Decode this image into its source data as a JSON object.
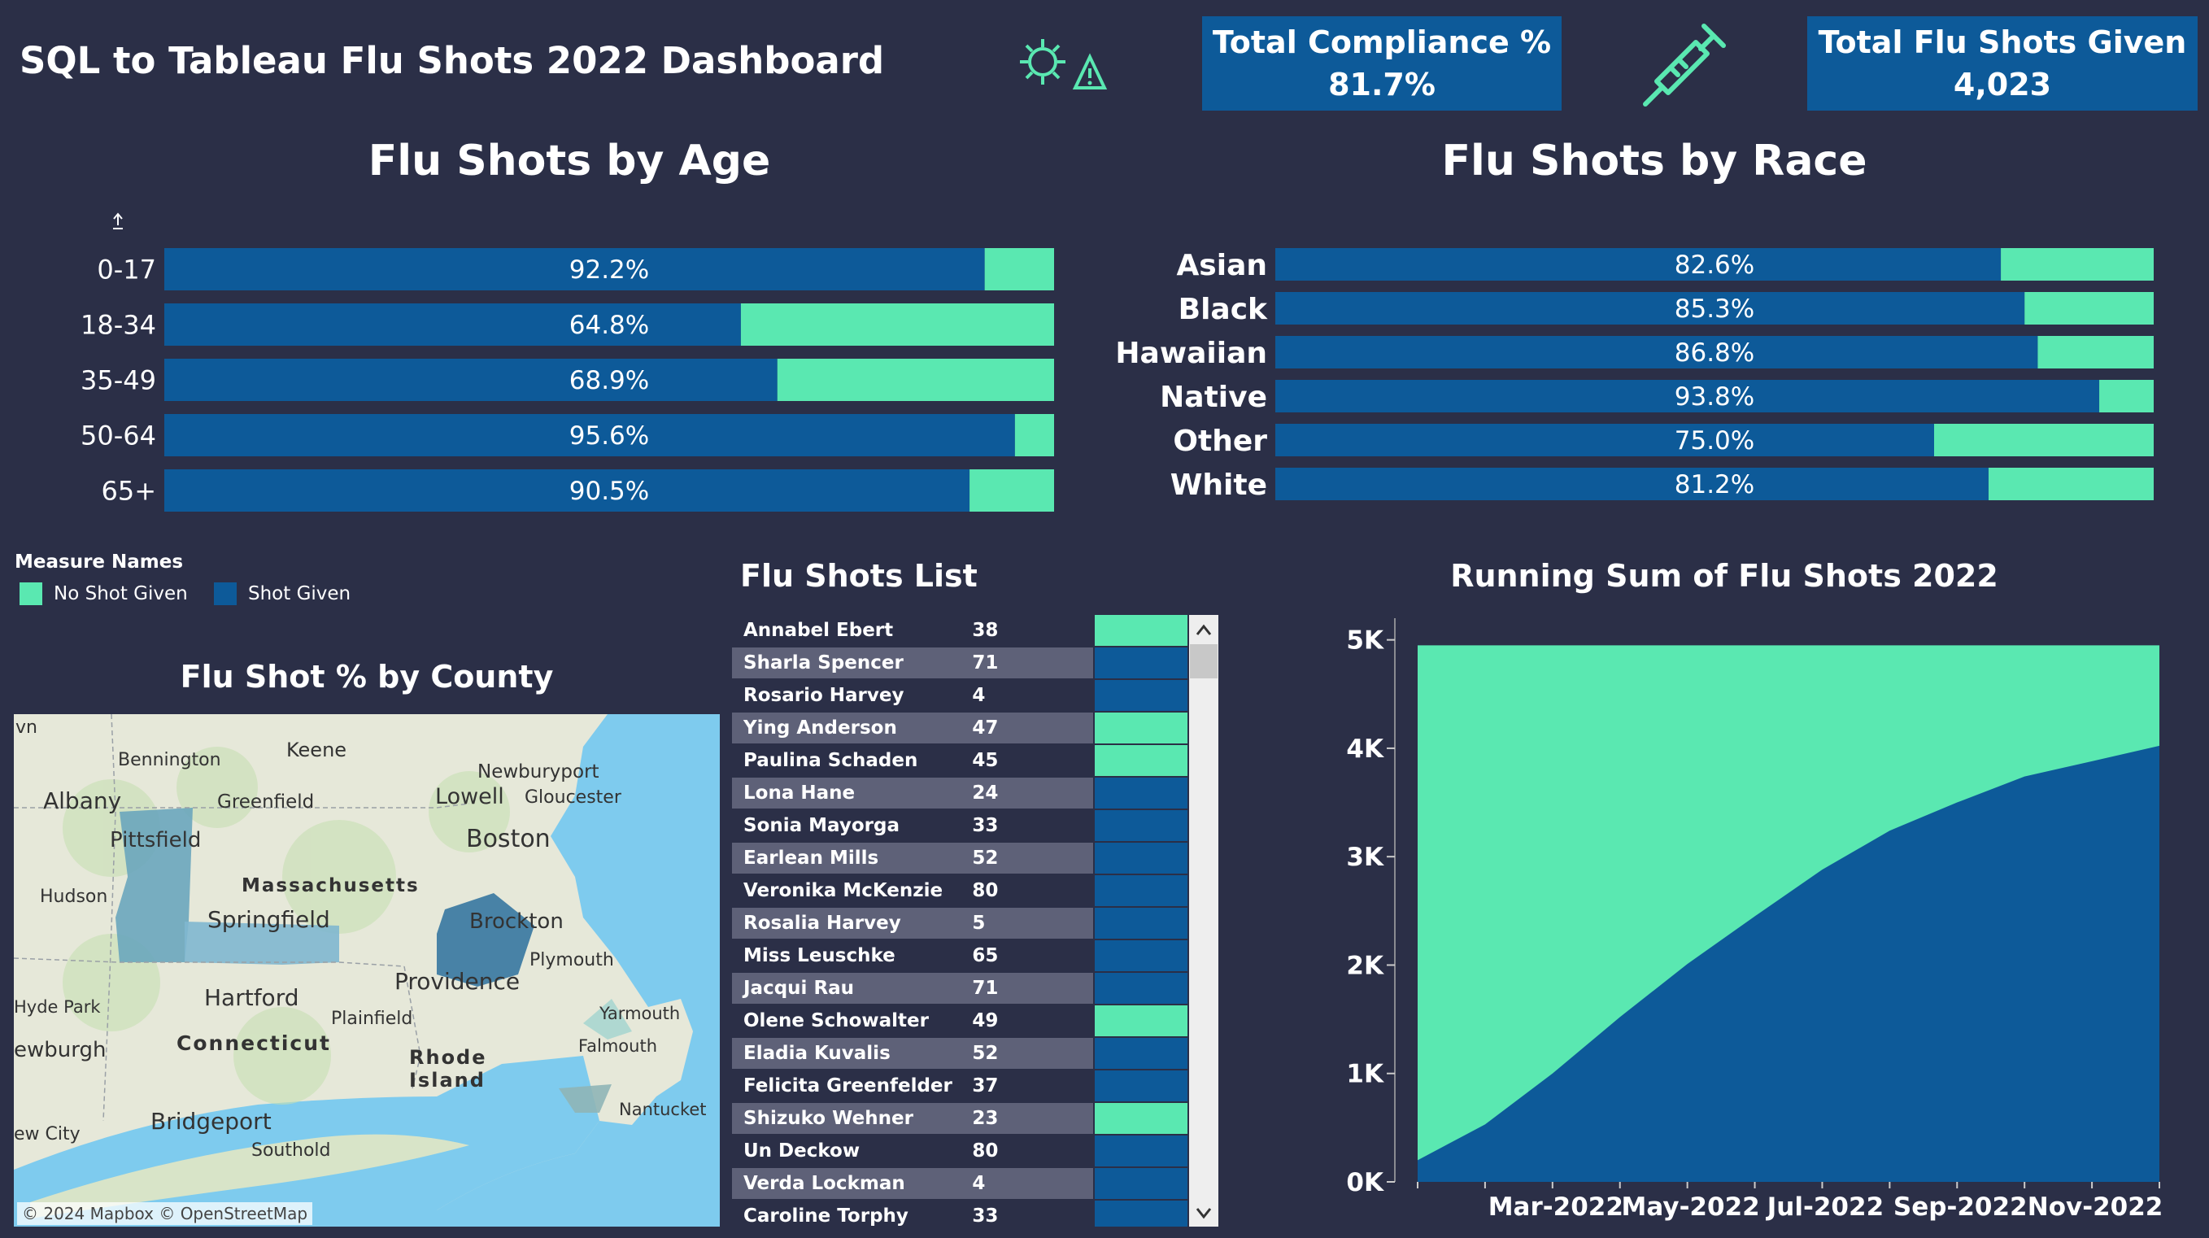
{
  "header": {
    "title": "SQL to Tableau Flu Shots 2022 Dashboard",
    "compliance_label": "Total Compliance %",
    "compliance_value": "81.7%",
    "total_label": "Total Flu Shots Given",
    "total_value": "4,023",
    "icons": [
      "virus-warning-icon",
      "syringe-icon"
    ]
  },
  "colors": {
    "shot_given": "#0d5a99",
    "no_shot": "#5ae8b1",
    "background": "#2b2f47"
  },
  "legend": {
    "title": "Measure Names",
    "items": [
      {
        "label": "No Shot Given",
        "color": "#5ae8b1"
      },
      {
        "label": "Shot Given",
        "color": "#0d5a99"
      }
    ]
  },
  "chart_data": [
    {
      "type": "bar",
      "title": "Flu Shots by Age",
      "categories": [
        "0-17",
        "18-34",
        "35-49",
        "50-64",
        "65+"
      ],
      "series": [
        {
          "name": "Shot Given",
          "values": [
            92.2,
            64.8,
            68.9,
            95.6,
            90.5
          ]
        },
        {
          "name": "No Shot Given",
          "values": [
            7.8,
            35.2,
            31.1,
            4.4,
            9.5
          ]
        }
      ],
      "labels": [
        "92.2%",
        "64.8%",
        "68.9%",
        "95.6%",
        "90.5%"
      ],
      "xlim": [
        0,
        100
      ]
    },
    {
      "type": "bar",
      "title": "Flu Shots by Race",
      "categories": [
        "Asian",
        "Black",
        "Hawaiian",
        "Native",
        "Other",
        "White"
      ],
      "series": [
        {
          "name": "Shot Given",
          "values": [
            82.6,
            85.3,
            86.8,
            93.8,
            75.0,
            81.2
          ]
        },
        {
          "name": "No Shot Given",
          "values": [
            17.4,
            14.7,
            13.2,
            6.2,
            25.0,
            18.8
          ]
        }
      ],
      "labels": [
        "82.6%",
        "85.3%",
        "86.8%",
        "93.8%",
        "75.0%",
        "81.2%"
      ],
      "xlim": [
        0,
        100
      ]
    },
    {
      "type": "area",
      "title": "Running Sum of Flu Shots 2022",
      "x": [
        "2022-01",
        "2022-02",
        "2022-03",
        "2022-04",
        "2022-05",
        "2022-06",
        "2022-07",
        "2022-08",
        "2022-09",
        "2022-10",
        "2022-11",
        "2022-12"
      ],
      "series": [
        {
          "name": "Shot Given",
          "values": [
            200,
            530,
            1000,
            1520,
            2010,
            2450,
            2880,
            3240,
            3500,
            3740,
            3880,
            4023
          ]
        },
        {
          "name": "No Shot Given",
          "values": [
            4750,
            4420,
            3950,
            3430,
            2940,
            2500,
            2070,
            1710,
            1450,
            1210,
            1070,
            927
          ]
        }
      ],
      "x_tick_labels": [
        "Mar-2022",
        "May-2022",
        "Jul-2022",
        "Sep-2022",
        "Nov-2022"
      ],
      "y_tick_labels": [
        "0K",
        "1K",
        "2K",
        "3K",
        "4K",
        "5K"
      ],
      "ylim": [
        0,
        5200
      ]
    }
  ],
  "map": {
    "title": "Flu Shot % by County",
    "attribution": "© 2024 Mapbox © OpenStreetMap",
    "places": [
      "vn",
      "Keene",
      "Bennington",
      "Newburyport",
      "Albany",
      "Greenfield",
      "Lowell",
      "Gloucester",
      "Pittsfield",
      "Boston",
      "Massachusetts",
      "Hudson",
      "Springfield",
      "Brockton",
      "Plymouth",
      "Providence",
      "Yarmouth",
      "Hyde Park",
      "Hartford",
      "Plainfield",
      "Falmouth",
      "ewburgh",
      "Connecticut",
      "Rhode",
      "Island",
      "Nantucket",
      "ew City",
      "Bridgeport",
      "Southold"
    ]
  },
  "list": {
    "title": "Flu Shots List",
    "rows": [
      {
        "name": "Annabel Ebert",
        "age": "38",
        "shot": false
      },
      {
        "name": "Sharla Spencer",
        "age": "71",
        "shot": true
      },
      {
        "name": "Rosario Harvey",
        "age": "4",
        "shot": true
      },
      {
        "name": "Ying Anderson",
        "age": "47",
        "shot": false
      },
      {
        "name": "Paulina Schaden",
        "age": "45",
        "shot": false
      },
      {
        "name": "Lona Hane",
        "age": "24",
        "shot": true
      },
      {
        "name": "Sonia Mayorga",
        "age": "33",
        "shot": true
      },
      {
        "name": "Earlean Mills",
        "age": "52",
        "shot": true
      },
      {
        "name": "Veronika McKenzie",
        "age": "80",
        "shot": true
      },
      {
        "name": "Rosalia Harvey",
        "age": "5",
        "shot": true
      },
      {
        "name": "Miss Leuschke",
        "age": "65",
        "shot": true
      },
      {
        "name": "Jacqui Rau",
        "age": "71",
        "shot": true
      },
      {
        "name": "Olene Schowalter",
        "age": "49",
        "shot": false
      },
      {
        "name": "Eladia Kuvalis",
        "age": "52",
        "shot": true
      },
      {
        "name": "Felicita Greenfelder",
        "age": "37",
        "shot": true
      },
      {
        "name": "Shizuko Wehner",
        "age": "23",
        "shot": false
      },
      {
        "name": "Un Deckow",
        "age": "80",
        "shot": true
      },
      {
        "name": "Verda Lockman",
        "age": "4",
        "shot": true
      },
      {
        "name": "Caroline Torphy",
        "age": "33",
        "shot": true
      }
    ]
  }
}
